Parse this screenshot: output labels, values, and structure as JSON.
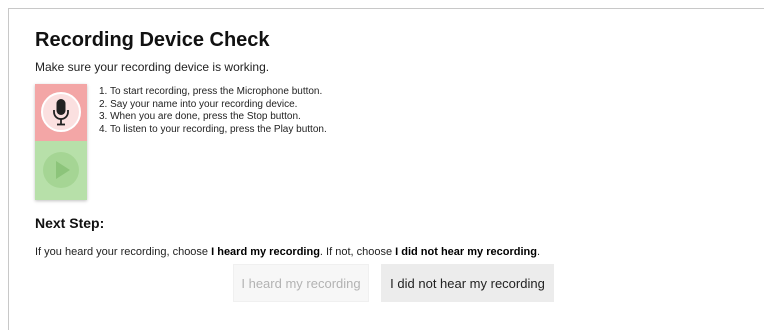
{
  "header": {
    "title": "Recording Device Check",
    "subtitle": "Make sure your recording device is working."
  },
  "device": {
    "record_button_icon": "microphone-icon",
    "play_button_icon": "play-icon",
    "colors": {
      "record_panel": "#f3a6a6",
      "play_panel": "#b7e0a9"
    }
  },
  "instructions": [
    "1. To start recording, press the Microphone button.",
    "2. Say your name into your recording device.",
    "3. When you are done, press the Stop button.",
    "4. To listen to your recording, press the Play button."
  ],
  "next_step": {
    "heading": "Next Step:",
    "text_prefix": "If you heard your recording, choose ",
    "option_heard": "I heard my recording",
    "text_middle": ". If not, choose ",
    "option_not_heard": "I did not hear my recording",
    "text_suffix": "."
  },
  "buttons": {
    "heard_label": "I heard my recording",
    "heard_enabled": false,
    "not_heard_label": "I did not hear my recording",
    "not_heard_enabled": true
  }
}
